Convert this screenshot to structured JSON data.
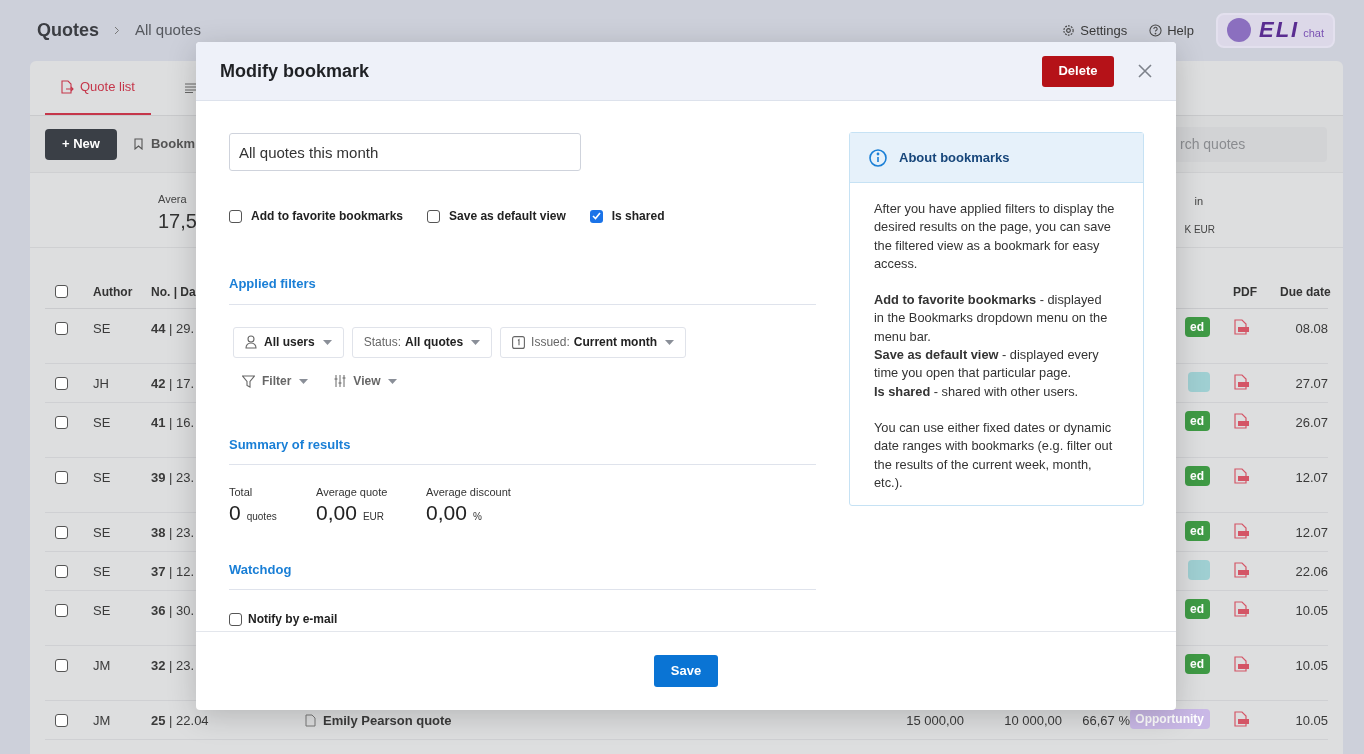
{
  "page": {
    "title": "Quotes",
    "breadcrumb": "All quotes",
    "header_links": [
      "Settings",
      "Help"
    ],
    "logo": {
      "name": "ELI",
      "suffix": "chat"
    }
  },
  "tabs": [
    {
      "label": "Quote list",
      "selected": true
    },
    {
      "selected": false
    }
  ],
  "toolbar": {
    "new_button": "+ New",
    "bookmarks": "Bookm",
    "search": {
      "placeholder": "rch quotes"
    }
  },
  "stats": {
    "left": {
      "label": "Avera",
      "value": "17,5"
    },
    "right": {
      "label": "in",
      "value": "K EUR"
    }
  },
  "table": {
    "select_all_checked": false,
    "columns": [
      "Author",
      "No. | Da",
      "PDF",
      "Due date"
    ],
    "rows": [
      {
        "checked": false,
        "author": "SE",
        "number": "**44** | 29.",
        "badge": {
          "text": "ed",
          "color": "#3f9a45"
        },
        "due": "08.08"
      },
      {
        "checked": false,
        "author": "JH",
        "number": "**42** | 17.",
        "badge": {
          "color": "#9fcfd2"
        },
        "due": "27.07"
      },
      {
        "checked": false,
        "author": "SE",
        "number": "**41** | 16.",
        "badge": {
          "text": "ed",
          "color": "#3f9a45"
        },
        "due": "26.07"
      },
      {
        "checked": false,
        "author": "SE",
        "number": "**39** | 23.",
        "badge": {
          "text": "ed",
          "color": "#3f9a45"
        },
        "due": "12.07"
      },
      {
        "checked": false,
        "author": "SE",
        "number": "**38** | 23.",
        "badge": {
          "text": "ed",
          "color": "#3f9a45"
        },
        "due": "12.07"
      },
      {
        "checked": false,
        "author": "SE",
        "number": "**37** | 12.",
        "badge": {
          "color": "#9fcfd2"
        },
        "due": "22.06"
      },
      {
        "checked": false,
        "author": "SE",
        "number": "**36** | 30.",
        "badge": {
          "text": "ed",
          "color": "#3f9a45"
        },
        "due": "10.05"
      },
      {
        "checked": false,
        "author": "JM",
        "number": "**32** | 23.",
        "badge": {
          "text": "ed",
          "color": "#3f9a45"
        },
        "due": "10.05"
      },
      {
        "checked": false,
        "author": "JM",
        "number": "**25** | 22.04",
        "title": "Emily Pearson quote",
        "amount": "15 000,00",
        "discounted": "10 000,00",
        "discount": "66,67 %",
        "badge": {
          "text": "Opportunity",
          "color": "#c9b8e6"
        },
        "due": "10.05"
      }
    ]
  },
  "dialog": {
    "title": "Modify bookmark",
    "delete_button": "Delete",
    "name_field": {
      "value": "All quotes this month"
    },
    "options": [
      {
        "label": "Add to favorite bookmarks",
        "checked": false
      },
      {
        "label": "Save as default view",
        "checked": false
      },
      {
        "label": "Is shared",
        "checked": true
      }
    ],
    "applied_filters": {
      "heading": "Applied filters",
      "filters": [
        {
          "kind": "user",
          "bordered": true,
          "value": "All users"
        },
        {
          "kind": "status",
          "bordered": true,
          "label": "Status:",
          "value": "All quotes"
        },
        {
          "kind": "date",
          "bordered": true,
          "label": "Issued:",
          "value": "Current month"
        },
        {
          "kind": "filter",
          "bordered": false,
          "value": "Filter"
        },
        {
          "kind": "view",
          "bordered": false,
          "value": "View"
        }
      ]
    },
    "summary": {
      "heading": "Summary of results",
      "items": [
        {
          "label": "Total",
          "value": "0",
          "unit": "quotes"
        },
        {
          "label": "Average quote",
          "value": "0,00",
          "unit": "EUR"
        },
        {
          "label": "Average discount",
          "value": "0,00",
          "unit": "%"
        }
      ]
    },
    "watchdog": {
      "heading": "Watchdog",
      "notify": {
        "label": "Notify by e-mail",
        "checked": false
      }
    },
    "save_button": "Save",
    "info": {
      "title": "About bookmarks",
      "paragraphs": [
        [
          "After you have applied filters to display the desired results on the page, you can save the filtered view as a bookmark for easy access."
        ],
        [
          "**Add to favorite bookmarks** - displayed in the Bookmarks dropdown menu on the menu bar.",
          "**Save as default view** - displayed every time you open that particular page.",
          "**Is shared** - shared with other users."
        ],
        [
          "You can use either fixed dates or dynamic date ranges with bookmarks (e.g. filter out the results of the current week, month, etc.)."
        ]
      ]
    }
  }
}
